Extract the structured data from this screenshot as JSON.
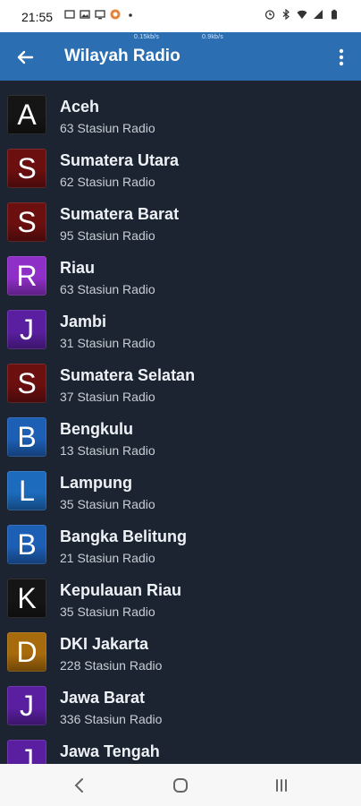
{
  "status_bar": {
    "time": "21:55",
    "left_icons": [
      "image-icon",
      "gallery-icon",
      "cast-icon",
      "app-badge-icon",
      "dot-icon"
    ],
    "right_icons": [
      "alarm-icon",
      "bluetooth-icon",
      "wifi-icon",
      "signal-icon",
      "battery-icon"
    ]
  },
  "app_bar": {
    "title": "Wilayah Radio",
    "speed_upload": "0.15kb/s",
    "speed_download": "0.9kb/s",
    "back_icon": "arrow-left-icon",
    "more_icon": "more-vert-icon",
    "color": "#2b6fb2"
  },
  "regions": [
    {
      "letter": "A",
      "name": "Aceh",
      "count": "63 Stasiun Radio",
      "color": "#151515"
    },
    {
      "letter": "S",
      "name": "Sumatera Utara",
      "count": "62 Stasiun Radio",
      "color": "#6b0f0f"
    },
    {
      "letter": "S",
      "name": "Sumatera Barat",
      "count": "95 Stasiun Radio",
      "color": "#6b0f0f"
    },
    {
      "letter": "R",
      "name": "Riau",
      "count": "63 Stasiun Radio",
      "color": "#8e2fc7"
    },
    {
      "letter": "J",
      "name": "Jambi",
      "count": "31 Stasiun Radio",
      "color": "#5a1fa0"
    },
    {
      "letter": "S",
      "name": "Sumatera Selatan",
      "count": "37 Stasiun Radio",
      "color": "#6b0f0f"
    },
    {
      "letter": "B",
      "name": "Bengkulu",
      "count": "13 Stasiun Radio",
      "color": "#1d5fb5"
    },
    {
      "letter": "L",
      "name": "Lampung",
      "count": "35 Stasiun Radio",
      "color": "#1d6bbd"
    },
    {
      "letter": "B",
      "name": "Bangka Belitung",
      "count": "21 Stasiun Radio",
      "color": "#1d5fb5"
    },
    {
      "letter": "K",
      "name": "Kepulauan Riau",
      "count": "35 Stasiun Radio",
      "color": "#151515"
    },
    {
      "letter": "D",
      "name": "DKI Jakarta",
      "count": "228 Stasiun Radio",
      "color": "#a76a0c"
    },
    {
      "letter": "J",
      "name": "Jawa Barat",
      "count": "336 Stasiun Radio",
      "color": "#5a1fa0"
    },
    {
      "letter": "J",
      "name": "Jawa Tengah",
      "count": "",
      "color": "#5a1fa0"
    }
  ],
  "nav_bar": {
    "back_icon": "nav-back-icon",
    "home_icon": "nav-home-icon",
    "recents_icon": "nav-recents-icon"
  }
}
